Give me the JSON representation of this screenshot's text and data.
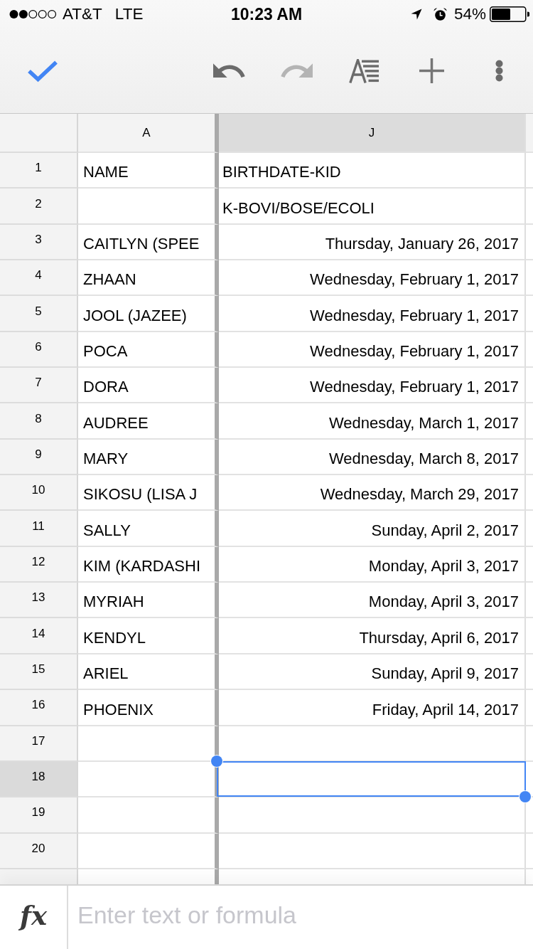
{
  "status_bar": {
    "carrier": "AT&T",
    "network": "LTE",
    "time": "10:23 AM",
    "battery": "54%"
  },
  "toolbar": [
    {
      "kind": "done",
      "disabled": false
    },
    {
      "kind": "undo",
      "disabled": false
    },
    {
      "kind": "redo",
      "disabled": true
    },
    {
      "kind": "text_format",
      "disabled": false
    },
    {
      "kind": "insert",
      "disabled": false
    },
    {
      "kind": "more",
      "disabled": false
    }
  ],
  "columns": [
    {
      "label": "A",
      "selected": false
    },
    {
      "label": "J",
      "selected": true
    }
  ],
  "rows": [
    {
      "number": "1",
      "selected": false,
      "cells": [
        {
          "kind": "text",
          "value": "NAME"
        },
        {
          "kind": "text",
          "value": "BIRTHDATE-KID"
        }
      ]
    },
    {
      "number": "2",
      "selected": false,
      "cells": [
        null,
        {
          "kind": "text",
          "value": "K-BOVI/BOSE/ECOLI"
        }
      ]
    },
    {
      "number": "3",
      "selected": false,
      "cells": [
        {
          "kind": "text",
          "value": "CAITLYN (SPEE"
        },
        {
          "kind": "date",
          "value": "Thursday, January 26, 2017"
        }
      ]
    },
    {
      "number": "4",
      "selected": false,
      "cells": [
        {
          "kind": "text",
          "value": "ZHAAN"
        },
        {
          "kind": "date",
          "value": "Wednesday, February 1, 2017"
        }
      ]
    },
    {
      "number": "5",
      "selected": false,
      "cells": [
        {
          "kind": "text",
          "value": "JOOL (JAZEE)"
        },
        {
          "kind": "date",
          "value": "Wednesday, February 1, 2017"
        }
      ]
    },
    {
      "number": "6",
      "selected": false,
      "cells": [
        {
          "kind": "text",
          "value": "POCA"
        },
        {
          "kind": "date",
          "value": "Wednesday, February 1, 2017"
        }
      ]
    },
    {
      "number": "7",
      "selected": false,
      "cells": [
        {
          "kind": "text",
          "value": "DORA"
        },
        {
          "kind": "date",
          "value": "Wednesday, February 1, 2017"
        }
      ]
    },
    {
      "number": "8",
      "selected": false,
      "cells": [
        {
          "kind": "text",
          "value": "AUDREE"
        },
        {
          "kind": "date",
          "value": "Wednesday, March 1, 2017"
        }
      ]
    },
    {
      "number": "9",
      "selected": false,
      "cells": [
        {
          "kind": "text",
          "value": "MARY"
        },
        {
          "kind": "date",
          "value": "Wednesday, March 8, 2017"
        }
      ]
    },
    {
      "number": "10",
      "selected": false,
      "cells": [
        {
          "kind": "text",
          "value": "SIKOSU (LISA J"
        },
        {
          "kind": "date",
          "value": "Wednesday, March 29, 2017"
        }
      ]
    },
    {
      "number": "11",
      "selected": false,
      "cells": [
        {
          "kind": "text",
          "value": "SALLY"
        },
        {
          "kind": "date",
          "value": "Sunday, April 2, 2017"
        }
      ]
    },
    {
      "number": "12",
      "selected": false,
      "cells": [
        {
          "kind": "text",
          "value": "KIM (KARDASHI"
        },
        {
          "kind": "date",
          "value": "Monday, April 3, 2017"
        }
      ]
    },
    {
      "number": "13",
      "selected": false,
      "cells": [
        {
          "kind": "text",
          "value": "MYRIAH"
        },
        {
          "kind": "date",
          "value": "Monday, April 3, 2017"
        }
      ]
    },
    {
      "number": "14",
      "selected": false,
      "cells": [
        {
          "kind": "text",
          "value": "KENDYL"
        },
        {
          "kind": "date",
          "value": "Thursday, April 6, 2017"
        }
      ]
    },
    {
      "number": "15",
      "selected": false,
      "cells": [
        {
          "kind": "text",
          "value": "ARIEL"
        },
        {
          "kind": "date",
          "value": "Sunday, April 9, 2017"
        }
      ]
    },
    {
      "number": "16",
      "selected": false,
      "cells": [
        {
          "kind": "text",
          "value": "PHOENIX"
        },
        {
          "kind": "date",
          "value": "Friday, April 14, 2017"
        }
      ]
    },
    {
      "number": "17",
      "selected": false
    },
    {
      "number": "18",
      "selected": true
    },
    {
      "number": "19",
      "selected": false
    },
    {
      "number": "20",
      "selected": false
    }
  ],
  "formula_bar": {
    "symbol": "fx",
    "placeholder": "Enter text or formula"
  }
}
